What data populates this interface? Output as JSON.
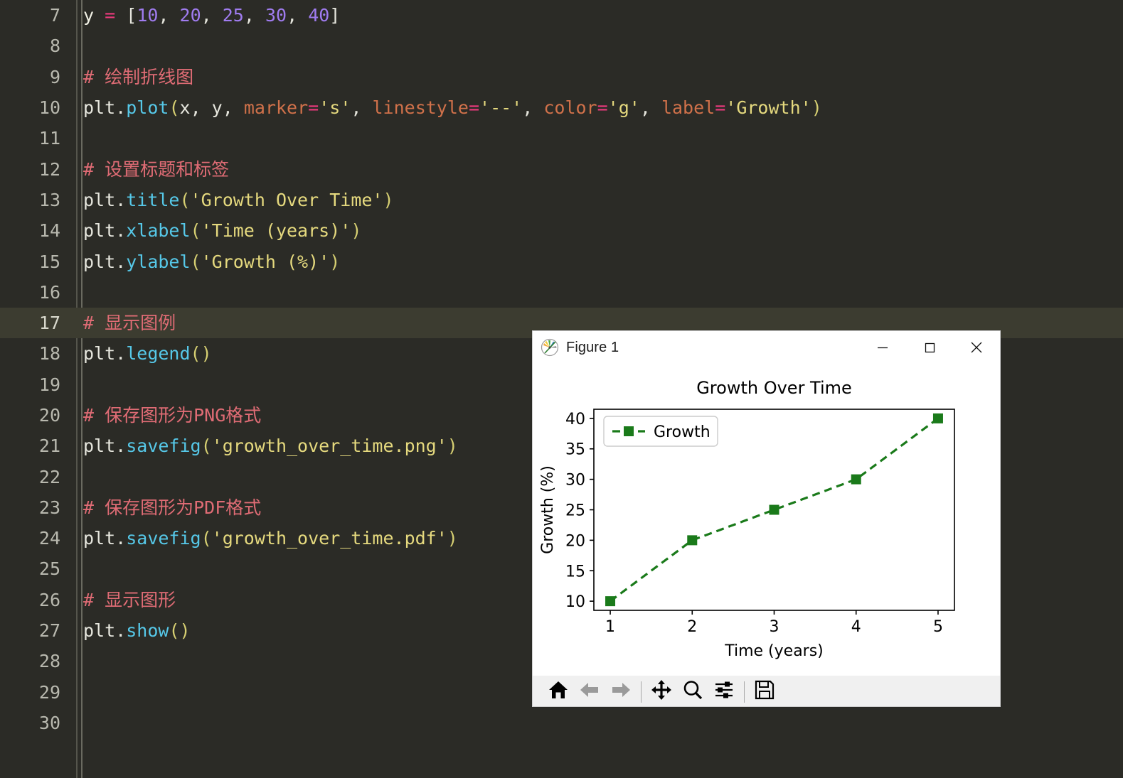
{
  "editor": {
    "theme": {
      "background": "#2b2b26",
      "active_line_background": "#3c3c30",
      "gutter_text": "#b8b8ae",
      "comment": "#e06c75",
      "function": "#56c8e8",
      "number": "#a07cf0",
      "string": "#e5d97e",
      "operator": "#ef3a7e",
      "kwarg": "#d0714a"
    },
    "active_line_number": 17,
    "lines": [
      {
        "number": "7",
        "tokens": [
          {
            "t": "y",
            "c": "t-var"
          },
          {
            "t": " ",
            "c": "t-plain"
          },
          {
            "t": "=",
            "c": "t-op"
          },
          {
            "t": " ",
            "c": "t-plain"
          },
          {
            "t": "[",
            "c": "t-plain"
          },
          {
            "t": "10",
            "c": "t-num"
          },
          {
            "t": ", ",
            "c": "t-plain"
          },
          {
            "t": "20",
            "c": "t-num"
          },
          {
            "t": ", ",
            "c": "t-plain"
          },
          {
            "t": "25",
            "c": "t-num"
          },
          {
            "t": ", ",
            "c": "t-plain"
          },
          {
            "t": "30",
            "c": "t-num"
          },
          {
            "t": ", ",
            "c": "t-plain"
          },
          {
            "t": "40",
            "c": "t-num"
          },
          {
            "t": "]",
            "c": "t-plain"
          }
        ]
      },
      {
        "number": "8",
        "tokens": []
      },
      {
        "number": "9",
        "tokens": [
          {
            "t": "# 绘制折线图",
            "c": "t-cmt"
          }
        ]
      },
      {
        "number": "10",
        "tokens": [
          {
            "t": "plt",
            "c": "t-plain"
          },
          {
            "t": ".",
            "c": "t-plain"
          },
          {
            "t": "plot",
            "c": "t-fn"
          },
          {
            "t": "(",
            "c": "t-paren"
          },
          {
            "t": "x",
            "c": "t-plain"
          },
          {
            "t": ", ",
            "c": "t-plain"
          },
          {
            "t": "y",
            "c": "t-plain"
          },
          {
            "t": ", ",
            "c": "t-plain"
          },
          {
            "t": "marker",
            "c": "t-kwarg"
          },
          {
            "t": "=",
            "c": "t-op"
          },
          {
            "t": "'s'",
            "c": "t-str"
          },
          {
            "t": ", ",
            "c": "t-plain"
          },
          {
            "t": "linestyle",
            "c": "t-kwarg"
          },
          {
            "t": "=",
            "c": "t-op"
          },
          {
            "t": "'--'",
            "c": "t-str"
          },
          {
            "t": ", ",
            "c": "t-plain"
          },
          {
            "t": "color",
            "c": "t-kwarg"
          },
          {
            "t": "=",
            "c": "t-op"
          },
          {
            "t": "'g'",
            "c": "t-str"
          },
          {
            "t": ", ",
            "c": "t-plain"
          },
          {
            "t": "label",
            "c": "t-kwarg"
          },
          {
            "t": "=",
            "c": "t-op"
          },
          {
            "t": "'Growth'",
            "c": "t-str"
          },
          {
            "t": ")",
            "c": "t-paren"
          }
        ]
      },
      {
        "number": "11",
        "tokens": []
      },
      {
        "number": "12",
        "tokens": [
          {
            "t": "# 设置标题和标签",
            "c": "t-cmt"
          }
        ]
      },
      {
        "number": "13",
        "tokens": [
          {
            "t": "plt",
            "c": "t-plain"
          },
          {
            "t": ".",
            "c": "t-plain"
          },
          {
            "t": "title",
            "c": "t-fn"
          },
          {
            "t": "(",
            "c": "t-paren"
          },
          {
            "t": "'Growth Over Time'",
            "c": "t-str"
          },
          {
            "t": ")",
            "c": "t-paren"
          }
        ]
      },
      {
        "number": "14",
        "tokens": [
          {
            "t": "plt",
            "c": "t-plain"
          },
          {
            "t": ".",
            "c": "t-plain"
          },
          {
            "t": "xlabel",
            "c": "t-fn"
          },
          {
            "t": "(",
            "c": "t-paren"
          },
          {
            "t": "'Time (years)'",
            "c": "t-str"
          },
          {
            "t": ")",
            "c": "t-paren"
          }
        ]
      },
      {
        "number": "15",
        "tokens": [
          {
            "t": "plt",
            "c": "t-plain"
          },
          {
            "t": ".",
            "c": "t-plain"
          },
          {
            "t": "ylabel",
            "c": "t-fn"
          },
          {
            "t": "(",
            "c": "t-paren"
          },
          {
            "t": "'Growth (%)'",
            "c": "t-str"
          },
          {
            "t": ")",
            "c": "t-paren"
          }
        ]
      },
      {
        "number": "16",
        "tokens": []
      },
      {
        "number": "17",
        "tokens": [
          {
            "t": "# 显示图例",
            "c": "t-cmt"
          }
        ]
      },
      {
        "number": "18",
        "tokens": [
          {
            "t": "plt",
            "c": "t-plain"
          },
          {
            "t": ".",
            "c": "t-plain"
          },
          {
            "t": "legend",
            "c": "t-fn"
          },
          {
            "t": "()",
            "c": "t-paren"
          }
        ]
      },
      {
        "number": "19",
        "tokens": []
      },
      {
        "number": "20",
        "tokens": [
          {
            "t": "# 保存图形为PNG格式",
            "c": "t-cmt"
          }
        ]
      },
      {
        "number": "21",
        "tokens": [
          {
            "t": "plt",
            "c": "t-plain"
          },
          {
            "t": ".",
            "c": "t-plain"
          },
          {
            "t": "savefig",
            "c": "t-fn"
          },
          {
            "t": "(",
            "c": "t-paren"
          },
          {
            "t": "'growth_over_time.png'",
            "c": "t-str"
          },
          {
            "t": ")",
            "c": "t-paren"
          }
        ]
      },
      {
        "number": "22",
        "tokens": []
      },
      {
        "number": "23",
        "tokens": [
          {
            "t": "# 保存图形为PDF格式",
            "c": "t-cmt"
          }
        ]
      },
      {
        "number": "24",
        "tokens": [
          {
            "t": "plt",
            "c": "t-plain"
          },
          {
            "t": ".",
            "c": "t-plain"
          },
          {
            "t": "savefig",
            "c": "t-fn"
          },
          {
            "t": "(",
            "c": "t-paren"
          },
          {
            "t": "'growth_over_time.pdf'",
            "c": "t-str"
          },
          {
            "t": ")",
            "c": "t-paren"
          }
        ]
      },
      {
        "number": "25",
        "tokens": []
      },
      {
        "number": "26",
        "tokens": [
          {
            "t": "# 显示图形",
            "c": "t-cmt"
          }
        ]
      },
      {
        "number": "27",
        "tokens": [
          {
            "t": "plt",
            "c": "t-plain"
          },
          {
            "t": ".",
            "c": "t-plain"
          },
          {
            "t": "show",
            "c": "t-fn"
          },
          {
            "t": "()",
            "c": "t-paren"
          }
        ]
      },
      {
        "number": "28",
        "tokens": []
      },
      {
        "number": "29",
        "tokens": []
      },
      {
        "number": "30",
        "tokens": []
      }
    ]
  },
  "figure_window": {
    "title": "Figure 1",
    "app_icon": "matplotlib-icon",
    "controls": {
      "minimize": "minimize-icon",
      "maximize": "maximize-icon",
      "close": "close-icon"
    },
    "toolbar": {
      "buttons": [
        {
          "name": "home-button",
          "icon": "home-icon",
          "tooltip": "Home",
          "enabled": true
        },
        {
          "name": "back-button",
          "icon": "back-arrow-icon",
          "tooltip": "Back",
          "enabled": false
        },
        {
          "name": "forward-button",
          "icon": "forward-arrow-icon",
          "tooltip": "Forward",
          "enabled": false
        },
        {
          "name": "pan-button",
          "icon": "pan-move-icon",
          "tooltip": "Pan",
          "enabled": true
        },
        {
          "name": "zoom-button",
          "icon": "magnifier-icon",
          "tooltip": "Zoom to rectangle",
          "enabled": true
        },
        {
          "name": "configure-button",
          "icon": "sliders-icon",
          "tooltip": "Configure subplots",
          "enabled": true
        },
        {
          "name": "save-button",
          "icon": "floppy-save-icon",
          "tooltip": "Save the figure",
          "enabled": true
        }
      ]
    }
  },
  "chart_data": {
    "type": "line",
    "title": "Growth Over Time",
    "xlabel": "Time (years)",
    "ylabel": "Growth (%)",
    "x": [
      1,
      2,
      3,
      4,
      5
    ],
    "series": [
      {
        "name": "Growth",
        "values": [
          10,
          20,
          25,
          30,
          40
        ],
        "color": "#1a7a1a",
        "linestyle": "--",
        "marker": "square"
      }
    ],
    "xticks": [
      "1",
      "2",
      "3",
      "4",
      "5"
    ],
    "yticks": [
      "10",
      "15",
      "20",
      "25",
      "30",
      "35",
      "40"
    ],
    "xlim": [
      0.8,
      5.2
    ],
    "ylim": [
      8.5,
      41.5
    ],
    "grid": false,
    "legend": {
      "entries": [
        "Growth"
      ],
      "position": "upper left"
    }
  }
}
